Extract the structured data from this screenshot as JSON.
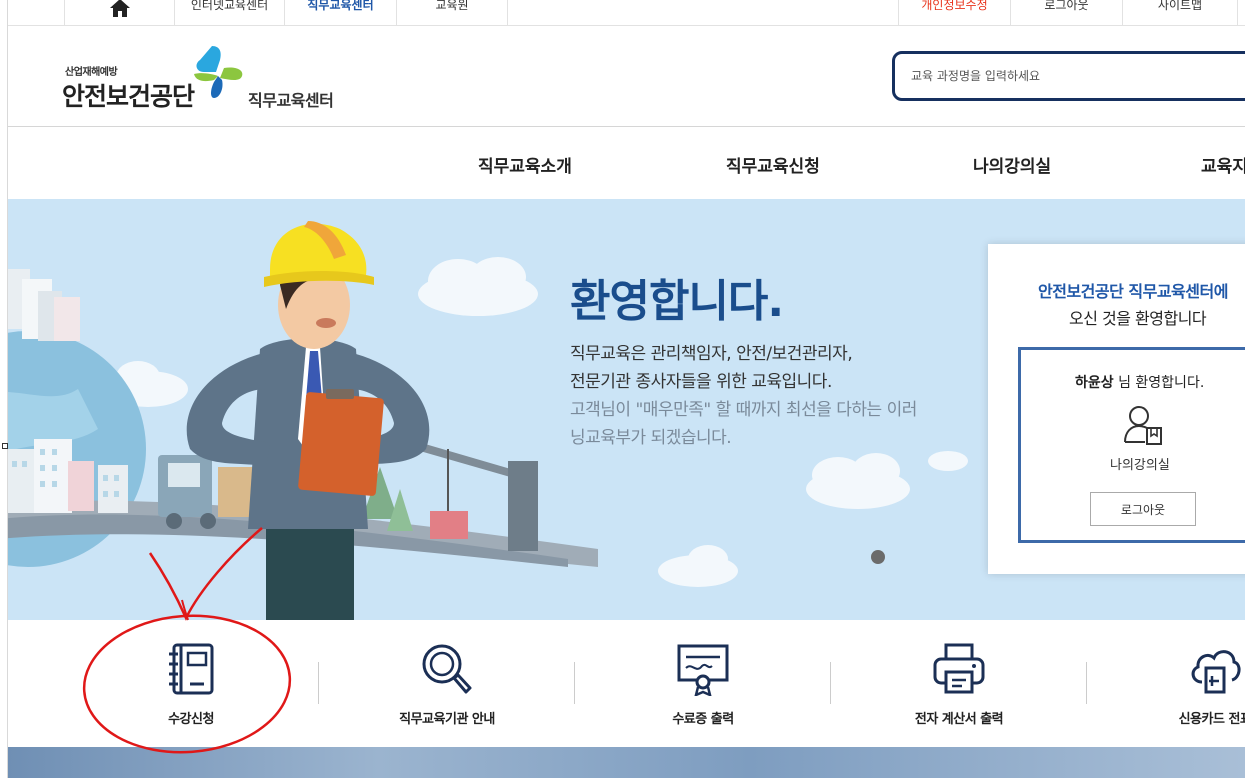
{
  "topbar": {
    "home_icon": "home-icon",
    "links": [
      "인터넷교육센터",
      "직무교육센터",
      "교육원"
    ],
    "right_links": [
      "개인정보수정",
      "로그아웃",
      "사이트맵"
    ]
  },
  "header": {
    "logo_small": "산업재해예방",
    "logo_big": "안전보건공단",
    "logo_sub": "직무교육센터",
    "search_placeholder": "교육 과정명을 입력하세요"
  },
  "nav": {
    "items": [
      "직무교육소개",
      "직무교육신청",
      "나의강의실",
      "교육지"
    ]
  },
  "hero": {
    "title": "환영합니다.",
    "lines": [
      "직무교육은 관리책임자, 안전/보건관리자,",
      "전문기관 종사자들을 위한 교육입니다.",
      "고객님이 \"매우만족\" 할 때까지 최선을 다하는 이러",
      "닝교육부가 되겠습니다."
    ]
  },
  "panel": {
    "title_line1": "안전보건공단 직무교육센터에",
    "title_line2": "오신 것을 환영합니다",
    "user_name": "하윤상",
    "user_suffix": " 님 환영합니다.",
    "myroom_label": "나의강의실",
    "logout_label": "로그아웃"
  },
  "quick": {
    "items": [
      {
        "label": "수강신청",
        "icon": "notebook-icon"
      },
      {
        "label": "직무교육기관 안내",
        "icon": "magnifier-icon"
      },
      {
        "label": "수료증 출력",
        "icon": "certificate-icon"
      },
      {
        "label": "전자 계산서 출력",
        "icon": "printer-icon"
      },
      {
        "label": "신용카드 전표",
        "icon": "cloud-document-icon"
      }
    ]
  },
  "colors": {
    "brand_navy": "#16305f",
    "brand_blue": "#1f57a8",
    "accent_red": "#e8341c",
    "hero_bg": "#cbe4f6",
    "annotation_red": "#e01818"
  }
}
